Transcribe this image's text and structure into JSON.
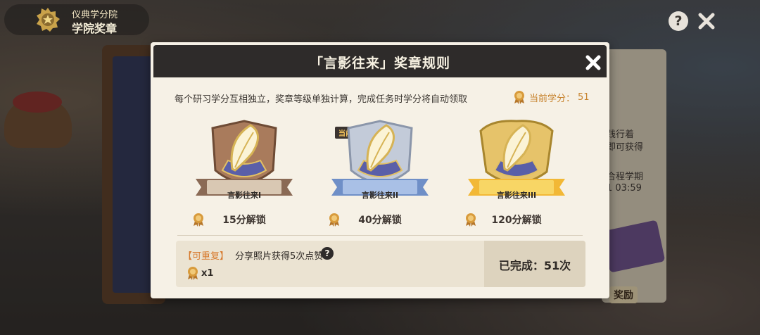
{
  "header": {
    "subtitle": "仪典学分院",
    "title": "学院奖章"
  },
  "topbar": {
    "help_label": "?"
  },
  "background": {
    "paper_lines": [
      "践行着",
      "即可获得",
      "合程学期",
      "1 03:59"
    ],
    "reward_label": "奖励"
  },
  "dialog": {
    "title": "「言影往来」奖章规则",
    "rule_text": "每个研习学分互相独立，奖章等级单独计算，完成任务时学分将自动领取",
    "current_credit_label": "当前学分：",
    "current_credit_value": "51",
    "current_tag": "当前",
    "badges": [
      {
        "name": "言影往来I",
        "unlock": "15分解锁",
        "tier": "bronze",
        "color": "#a97b5c",
        "ribbon": "#8a6a55"
      },
      {
        "name": "言影往来II",
        "unlock": "40分解锁",
        "tier": "silver",
        "color": "#b9c3d6",
        "ribbon": "#6f8fc7"
      },
      {
        "name": "言影往来III",
        "unlock": "120分解锁",
        "tier": "gold",
        "color": "#e6c36a",
        "ribbon": "#f2b836"
      }
    ],
    "task": {
      "tag": "【可重复】",
      "text": "分享照片获得5次点赞",
      "help_label": "?",
      "reward_count": "x1",
      "done_label": "已完成：51次"
    }
  },
  "colors": {
    "accent": "#c7832e",
    "dialog_bg": "#f6f1e6",
    "header_bg": "#2e2b2a"
  }
}
